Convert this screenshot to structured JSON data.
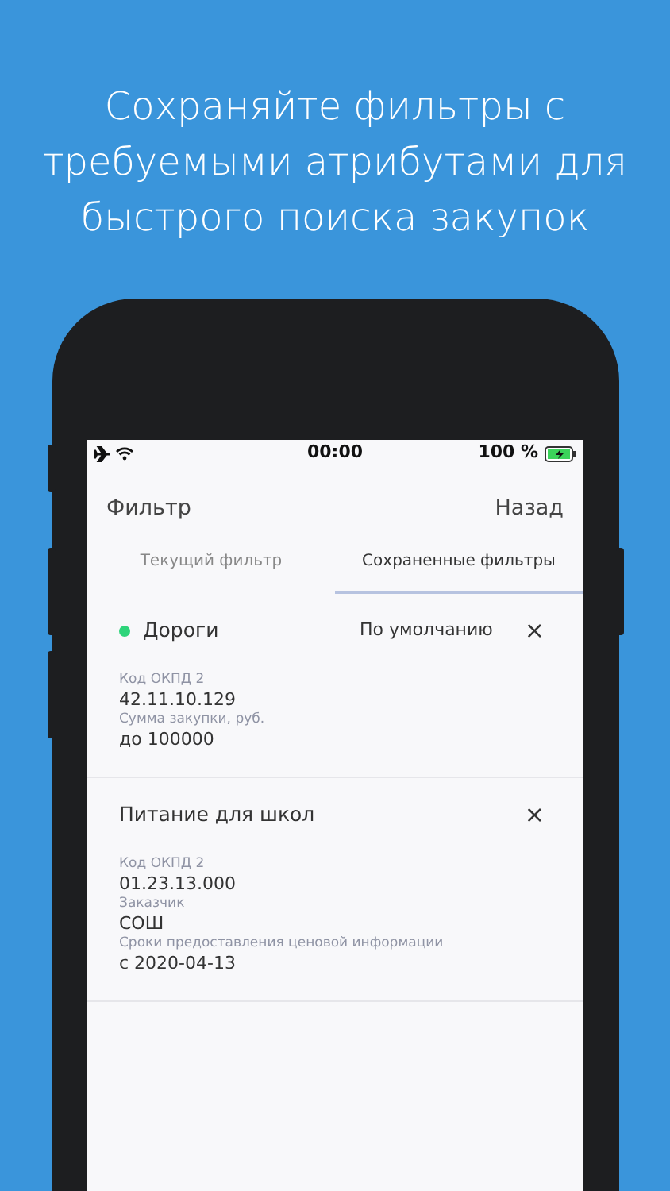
{
  "headline": "Сохраняйте фильтры с требуемыми атрибутами для быстрого поиска закупок",
  "status_bar": {
    "time": "00:00",
    "battery_text": "100 %"
  },
  "header": {
    "title": "Фильтр",
    "back": "Назад"
  },
  "tabs": [
    {
      "label": "Текущий фильтр",
      "selected": false
    },
    {
      "label": "Сохраненные фильтры",
      "selected": true
    }
  ],
  "filters": [
    {
      "name": "Дороги",
      "default": true,
      "default_label": "По умолчанию",
      "close": "×",
      "fields": [
        {
          "label": "Код ОКПД 2",
          "value": "42.11.10.129"
        },
        {
          "label": "Сумма закупки, руб.",
          "value": "до 100000"
        }
      ]
    },
    {
      "name": "Питание для школ",
      "default": false,
      "close": "×",
      "fields": [
        {
          "label": "Код ОКПД 2",
          "value": "01.23.13.000"
        },
        {
          "label": "Заказчик",
          "value": "СОШ"
        },
        {
          "label": "Сроки предоставления ценовой информации",
          "value": "с 2020-04-13"
        }
      ]
    }
  ]
}
